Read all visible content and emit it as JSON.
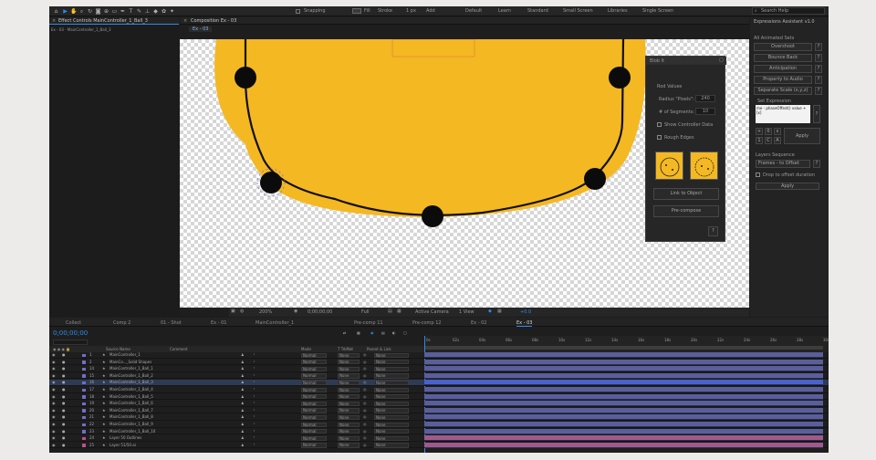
{
  "toolbar": {
    "snapping": "Snapping",
    "fill_label": "Fill",
    "stroke_label": "Stroke",
    "stroke_px": "1 px",
    "add_label": "Add",
    "workspaces": [
      "Default",
      "Learn",
      "Standard",
      "Small Screen",
      "Libraries",
      "Single Screen"
    ],
    "search_help": "Search Help"
  },
  "effect_controls": {
    "tab_label": "Effect Controls MainController_1_Ball_3",
    "subtitle": "Ex - 03 · MainController_1_Ball_3"
  },
  "composition": {
    "tab_label": "Composition Ex - 03",
    "subtab": "Ex - 03"
  },
  "viewer_footer": {
    "zoom": "200%",
    "timecode": "0;00;00;00",
    "resolution": "Full",
    "camera": "Active Camera",
    "view": "1 View",
    "offset": "+0.0"
  },
  "rubberhose": {
    "title": "Blob It",
    "section": "Rod Values",
    "radius_label": "Radius \"Pixels\":",
    "radius_value": "240",
    "segments_label": "# of Segments:",
    "segments_value": "10",
    "show_controller_data": "Show Controller Data",
    "rough_edges": "Rough Edges",
    "link_button": "Link to Object",
    "precompose_button": "Pre-compose"
  },
  "expressions_panel": {
    "title": "Expressions Assistant v1.0",
    "section_title": "All Animated Sets",
    "buttons": [
      "Overshoot",
      "Bounce Back",
      "Anticipation",
      "Property to Audio",
      "Separate Scale (x,y,z)"
    ],
    "set_expression": "Set Expression",
    "expression_text": "me - phaseOffset() value + [x]",
    "apply_label": "Apply",
    "layers_sequence": "Layers Sequence",
    "sequence_select": "Frames - to Offset",
    "drop_label": "Drop to offset duration",
    "apply2_label": "Apply",
    "mini_buttons": [
      "+",
      "0",
      "x",
      "1",
      "C",
      "A"
    ]
  },
  "timeline": {
    "tabs": [
      "Collect",
      "Comp 2",
      "01 - Shot",
      "Ex - 01",
      "MainController_1",
      "Pre-comp 11",
      "Pre-comp 12",
      "Ex - 02",
      "Ex - 03"
    ],
    "active_tab": "Ex - 03",
    "timecode": "0;00;00;00",
    "headers": {
      "source": "Source Name",
      "comment": "Comment",
      "mode": "Mode",
      "trkmat": "T TrkMat",
      "parent": "Parent & Link"
    },
    "ruler": [
      "0s",
      "02s",
      "04s",
      "06s",
      "08s",
      "10s",
      "12s",
      "14s",
      "16s",
      "18s",
      "20s",
      "22s",
      "24s",
      "26s",
      "28s",
      "30s"
    ],
    "layers": [
      {
        "num": "1",
        "name": "MainController_1",
        "mode": "Normal",
        "trk": "None",
        "parent": "None"
      },
      {
        "num": "2",
        "name": "MainCo..._Solid Shapes",
        "mode": "Normal",
        "trk": "None",
        "parent": "None"
      },
      {
        "num": "14",
        "name": "MainController_1_Ball_1",
        "mode": "Normal",
        "trk": "None",
        "parent": "None"
      },
      {
        "num": "15",
        "name": "MainController_1_Ball_2",
        "mode": "Normal",
        "trk": "None",
        "parent": "None"
      },
      {
        "num": "16",
        "name": "MainController_1_Ball_3",
        "mode": "Normal",
        "trk": "None",
        "parent": "None"
      },
      {
        "num": "17",
        "name": "MainController_1_Ball_4",
        "mode": "Normal",
        "trk": "None",
        "parent": "None"
      },
      {
        "num": "18",
        "name": "MainController_1_Ball_5",
        "mode": "Normal",
        "trk": "None",
        "parent": "None"
      },
      {
        "num": "19",
        "name": "MainController_1_Ball_6",
        "mode": "Normal",
        "trk": "None",
        "parent": "None"
      },
      {
        "num": "20",
        "name": "MainController_1_Ball_7",
        "mode": "Normal",
        "trk": "None",
        "parent": "None"
      },
      {
        "num": "21",
        "name": "MainController_1_Ball_8",
        "mode": "Normal",
        "trk": "None",
        "parent": "None"
      },
      {
        "num": "22",
        "name": "MainController_1_Ball_9",
        "mode": "Normal",
        "trk": "None",
        "parent": "None"
      },
      {
        "num": "23",
        "name": "MainController_1_Ball_10",
        "mode": "Normal",
        "trk": "None",
        "parent": "None"
      },
      {
        "num": "24",
        "name": "Layer 50 Outlines",
        "mode": "Normal",
        "trk": "None",
        "parent": "None"
      },
      {
        "num": "25",
        "name": "Layer 51/50.ai",
        "mode": "Normal",
        "trk": "None",
        "parent": "None"
      }
    ]
  },
  "colors": {
    "blob_fill": "#f4b822",
    "accent_blue": "#2d8ceb",
    "layer_bar": "#5a5f9a",
    "layer_bar_pink": "#a05a8a"
  }
}
